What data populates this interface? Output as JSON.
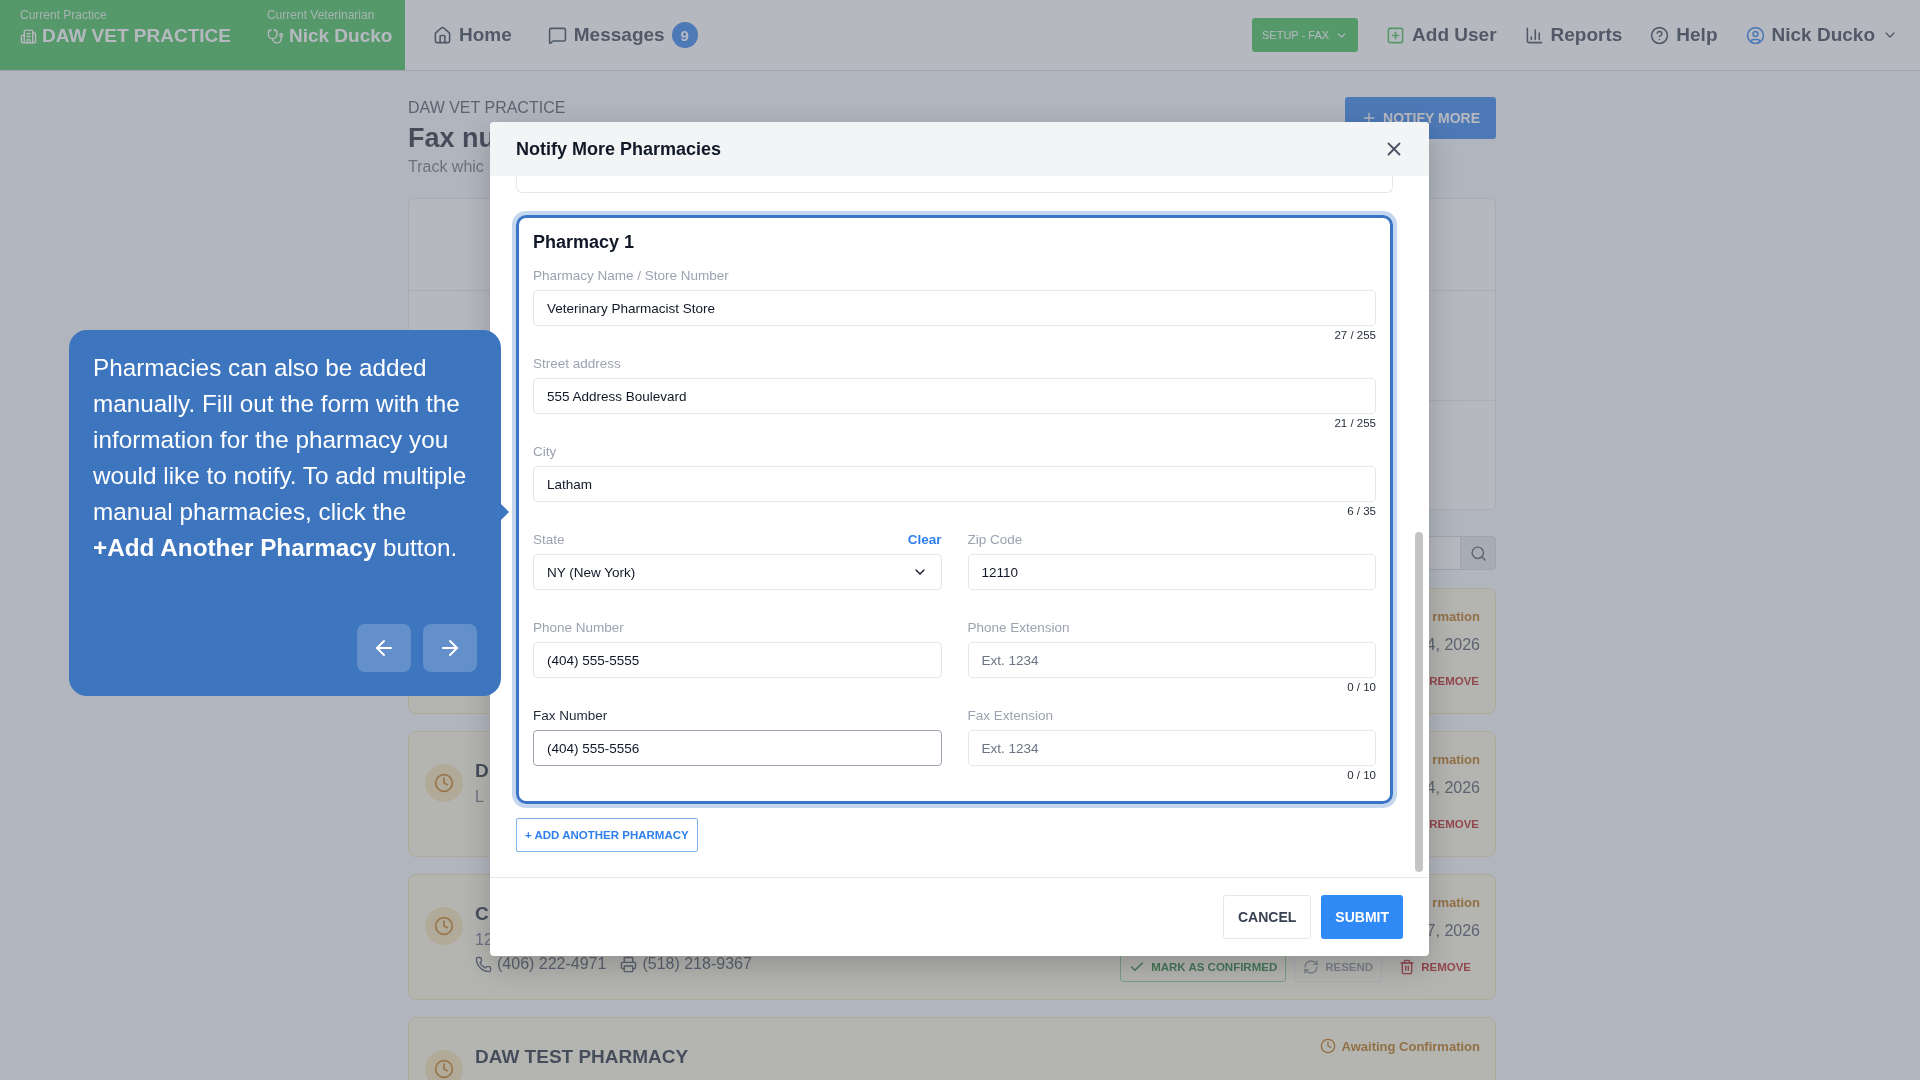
{
  "header": {
    "practice_label": "Current Practice",
    "practice": "DAW VET PRACTICE",
    "vet_label": "Current Veterinarian",
    "vet": "Nick Ducko",
    "nav": [
      {
        "kind": "home",
        "label": "Home"
      },
      {
        "kind": "messages",
        "label": "Messages",
        "badge": "9"
      }
    ],
    "setup": "SETUP - FAX",
    "actions": [
      {
        "kind": "add_user",
        "label": "Add User"
      },
      {
        "kind": "reports",
        "label": "Reports"
      },
      {
        "kind": "help",
        "label": "Help"
      },
      {
        "kind": "user",
        "label": "Nick Ducko"
      }
    ]
  },
  "page": {
    "breadcrumb": "DAW VET PRACTICE",
    "title": "Fax nu",
    "subtitle": "Track whic",
    "notify_button": "NOTIFY MORE"
  },
  "cards": [
    {
      "icon": false,
      "status": "rmation",
      "status_icon": false,
      "date": "4, 2026",
      "actions": [
        {
          "kind": "remove",
          "label": "REMOVE",
          "icon": false
        }
      ]
    },
    {
      "icon": true,
      "title": "D",
      "subtitle": "L",
      "status": "rmation",
      "status_icon": false,
      "date": "4, 2026",
      "actions": [
        {
          "kind": "remove",
          "label": "REMOVE",
          "icon": false
        }
      ]
    },
    {
      "icon": true,
      "title": "C",
      "subtitle": "12",
      "phones": [
        {
          "kind": "phone",
          "text": "(406) 222-4971"
        },
        {
          "kind": "fax",
          "text": "(518) 218-9367"
        }
      ],
      "status": "rmation",
      "status_icon": false,
      "date": "7, 2026",
      "actions": [
        {
          "kind": "confirm",
          "label": "MARK AS CONFIRMED",
          "icon": true
        },
        {
          "kind": "resend",
          "label": "RESEND",
          "icon": true,
          "disabled": true
        },
        {
          "kind": "remove",
          "label": "REMOVE",
          "icon": true
        }
      ]
    },
    {
      "icon": true,
      "title": "DAW TEST PHARMACY",
      "status": "Awaiting Confirmation",
      "status_icon": true
    }
  ],
  "modal": {
    "title": "Notify More Pharmacies",
    "pharmacy_title": "Pharmacy 1",
    "rows": [
      [
        {
          "kind": "text",
          "label": "Pharmacy Name / Store Number",
          "value": "Veterinary Pharmacist Store",
          "counter": "27 / 255",
          "focused": false
        }
      ],
      [
        {
          "kind": "text",
          "label": "Street address",
          "value": "555 Address Boulevard",
          "counter": "21 / 255",
          "focused": false
        }
      ],
      [
        {
          "kind": "text",
          "label": "City",
          "value": "Latham",
          "counter": "6 / 35",
          "focused": false
        }
      ],
      [
        {
          "kind": "select",
          "label": "State",
          "value": "NY (New York)",
          "clear": "Clear",
          "focused": false
        },
        {
          "kind": "text",
          "label": "Zip Code",
          "value": "12110",
          "focused": false
        }
      ],
      [
        {
          "kind": "text",
          "label": "Phone Number",
          "value": "(404) 555-5555",
          "focused": false
        },
        {
          "kind": "text",
          "label": "Phone Extension",
          "placeholder": "Ext. 1234",
          "counter": "0 / 10",
          "focused": false
        }
      ],
      [
        {
          "kind": "text",
          "label": "Fax Number",
          "value": "(404) 555-5556",
          "focused": true
        },
        {
          "kind": "text",
          "label": "Fax Extension",
          "placeholder": "Ext. 1234",
          "counter": "0 / 10",
          "focused": false
        }
      ]
    ],
    "add_button": "+ ADD ANOTHER PHARMACY",
    "cancel": "CANCEL",
    "submit": "SUBMIT"
  },
  "tooltip": {
    "text": "Pharmacies can also be added manually. Fill out the form with the information for the pharmacy you would like to notify. To add multiple manual pharmacies, click the **+Add Another Pharmacy** button."
  }
}
